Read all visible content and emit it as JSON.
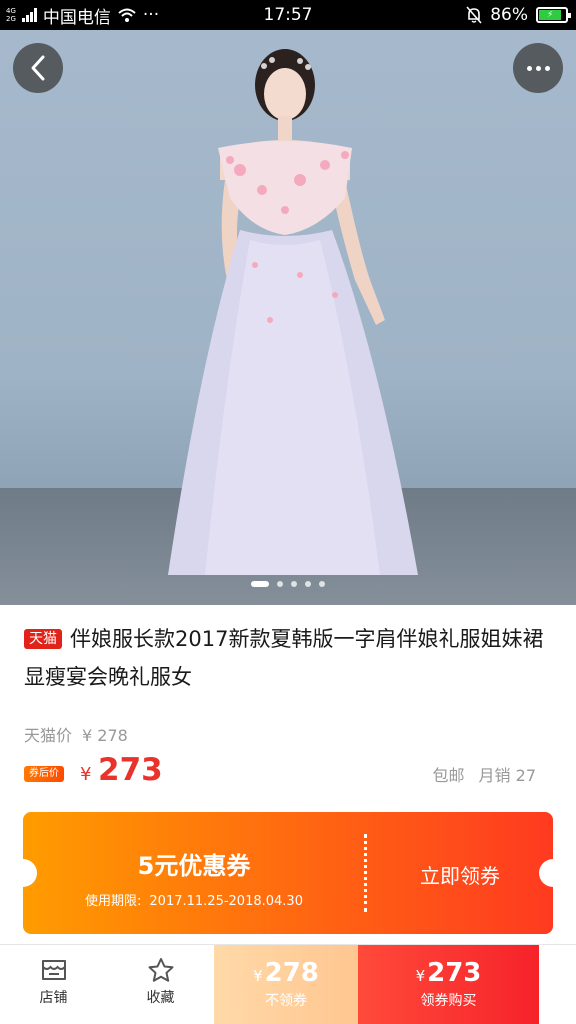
{
  "status_bar": {
    "network_type": [
      "4G",
      "2G"
    ],
    "carrier": "中国电信",
    "signal_dots": "···",
    "time": "17:57",
    "battery": "86%"
  },
  "hero": {
    "slide_count": 5,
    "active_slide": 1
  },
  "product": {
    "badge": "天猫",
    "title": "伴娘服长款2017新款夏韩版一字肩伴娘礼服姐妹裙显瘦宴会晚礼服女",
    "orig_label": "天猫价",
    "orig_price": "¥ 278",
    "after_badge": "券后价",
    "price_yen": "¥",
    "price": "273",
    "shipping": "包邮",
    "monthly_sales": "月销 27"
  },
  "coupon": {
    "amount": "5元优惠券",
    "date_label": "使用期限:",
    "date_range": "2017.11.25-2018.04.30",
    "claim": "立即领券"
  },
  "bottom_bar": {
    "store_label": "店铺",
    "fav_label": "收藏",
    "no_coupon_yen": "¥",
    "no_coupon_price": "278",
    "no_coupon_label": "不领券",
    "coupon_yen": "¥",
    "coupon_price": "273",
    "coupon_label": "领券购买"
  },
  "colors": {
    "accent_red": "#e9322b",
    "coupon_orange": "#ff6a10",
    "tmall_red": "#e2231a"
  }
}
